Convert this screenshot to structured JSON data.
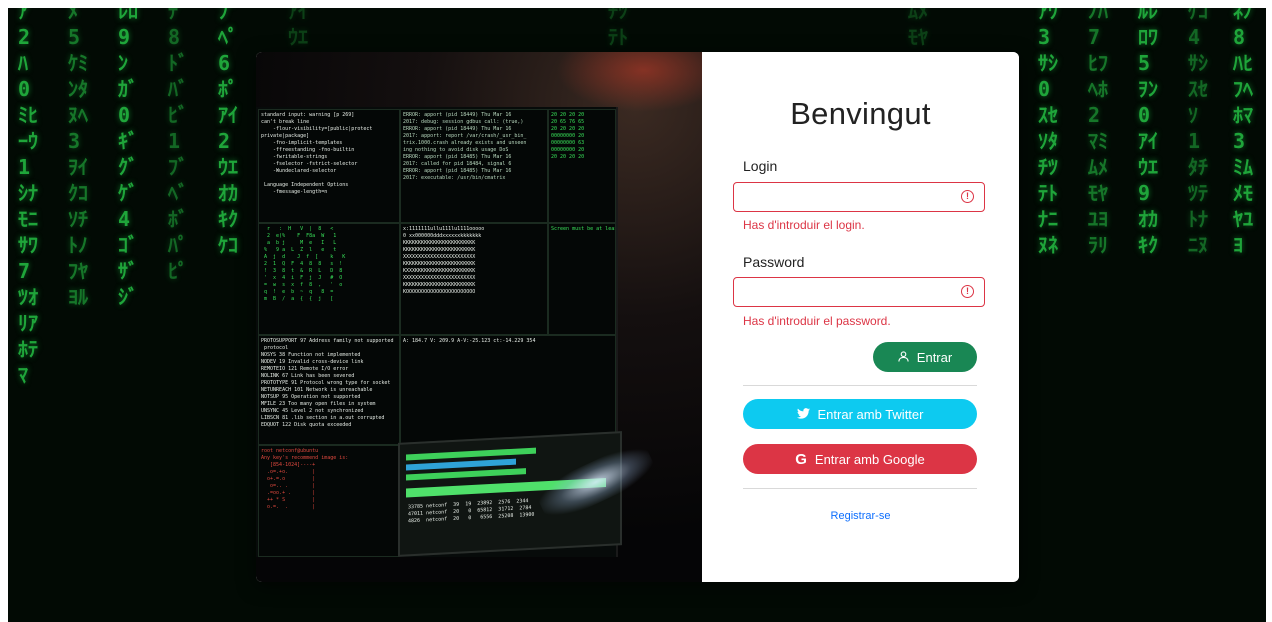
{
  "form": {
    "title": "Benvingut",
    "login_label": "Login",
    "login_value": "",
    "login_error": "Has d'introduir el login.",
    "password_label": "Password",
    "password_value": "",
    "password_error": "Has d'introduir el password.",
    "enter_label": "Entrar",
    "twitter_label": "Entrar amb Twitter",
    "google_label": "Entrar amb Google",
    "register_label": "Registrar-se"
  },
  "icons": {
    "enter": "user-icon",
    "twitter": "twitter-icon",
    "google": "google-icon",
    "input_error": "alert-circle-icon"
  },
  "colors": {
    "success": "#198754",
    "twitter": "#0dcaf0",
    "danger": "#dc3545",
    "link": "#0d6efd"
  }
}
